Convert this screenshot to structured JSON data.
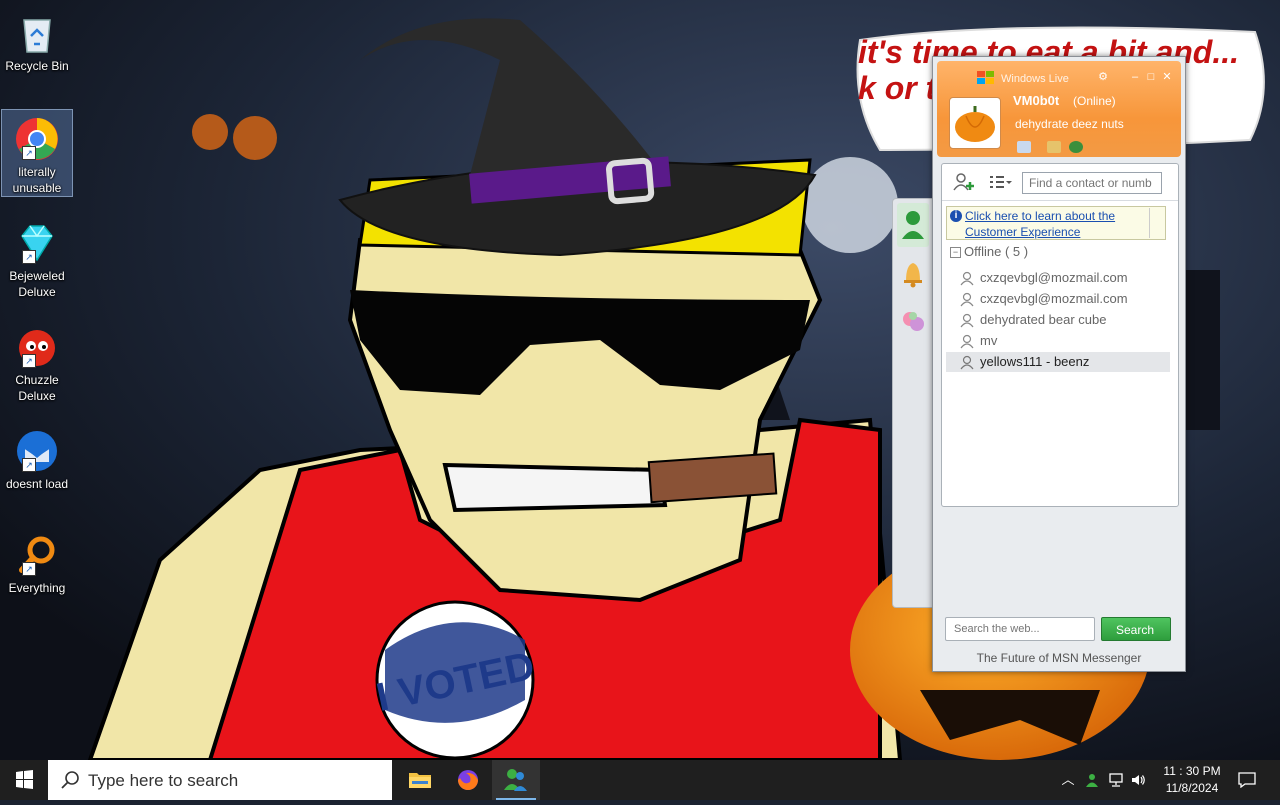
{
  "desktop": {
    "icons": [
      {
        "label": "Recycle Bin",
        "icon": "recycle-bin-icon"
      },
      {
        "label": "literally unusable",
        "icon": "chrome-icon"
      },
      {
        "label": "Bejeweled Deluxe",
        "icon": "diamond-icon"
      },
      {
        "label": "Chuzzle Deluxe",
        "icon": "chuzzle-icon"
      },
      {
        "label": "doesnt load",
        "icon": "thunderbird-icon"
      },
      {
        "label": "Everything",
        "icon": "magnifier-icon"
      }
    ]
  },
  "wallpaper": {
    "bubble_text": "it's time to eat a bit and... k or t",
    "badge_text": "I VOTED"
  },
  "messenger": {
    "title": "Windows Live",
    "username": "VM0b0t",
    "status": "(Online)",
    "personal_message": "dehydrate deez nuts",
    "find_placeholder": "Find a contact or numb",
    "info_link": "Click here to learn about the Customer Experience",
    "group": "Offline ( 5 )",
    "contacts": [
      "cxzqevbgl@mozmail.com",
      "cxzqevbgl@mozmail.com",
      "dehydrated bear cube",
      "mv",
      "yellows111 - beenz"
    ],
    "web_search_placeholder": "Search the web...",
    "search_button": "Search",
    "footer": "The Future of MSN Messenger",
    "colors": {
      "header": "#f7963a",
      "search_button": "#2e9e3d"
    }
  },
  "taskbar": {
    "search_placeholder": "Type here to search",
    "time": "11 : 30 PM",
    "date": "11/8/2024"
  }
}
